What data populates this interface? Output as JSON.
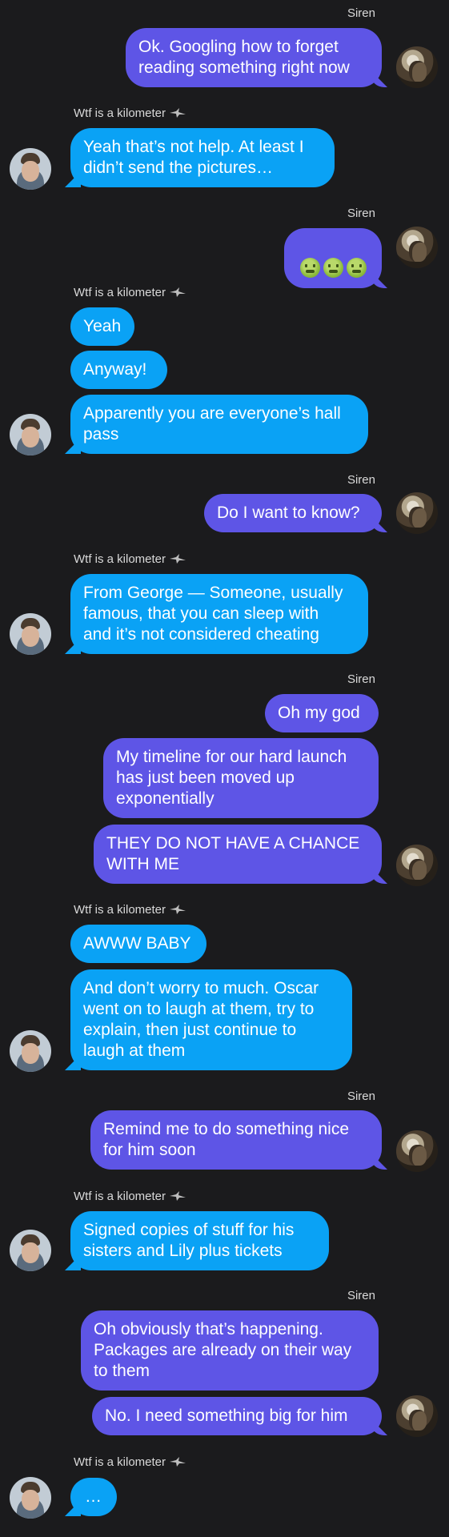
{
  "senders": {
    "siren": "Siren",
    "kilometer": "Wtf is a kilometer"
  },
  "icons": {
    "sender_badge": "hawk-icon",
    "emoji": "nauseated-face-icon"
  },
  "colors": {
    "background": "#1b1b1d",
    "outgoing_bubble": "#5e55e6",
    "incoming_bubble": "#0aa2f5"
  },
  "messages": {
    "m1": "Ok. Googling how to forget\nreading something right now",
    "m2": "Yeah that’s not help. At least I\ndidn’t send the pictures…",
    "m3_emoji_count": 3,
    "m4": "Yeah",
    "m5": "Anyway!",
    "m6": "Apparently you are everyone’s hall\npass",
    "m7": "Do I want to know?",
    "m8": "From George — Someone, usually\nfamous, that you can sleep with\nand it’s not considered cheating",
    "m9": "Oh my god",
    "m10": "My timeline for our hard launch\nhas just been moved up\nexponentially",
    "m11": "THEY DO NOT HAVE A CHANCE\nWITH ME",
    "m12": "AWWW BABY",
    "m13": "And don’t worry to much. Oscar\nwent on to laugh at them, try to\nexplain, then just continue to\nlaugh at them",
    "m14": "Remind me to do something nice\nfor him soon",
    "m15": "Signed copies of stuff for his\nsisters and Lily plus tickets",
    "m16": "Oh obviously that’s happening.\nPackages are already on their way\nto them",
    "m17": "No. I need something big for him",
    "m18": "…"
  }
}
